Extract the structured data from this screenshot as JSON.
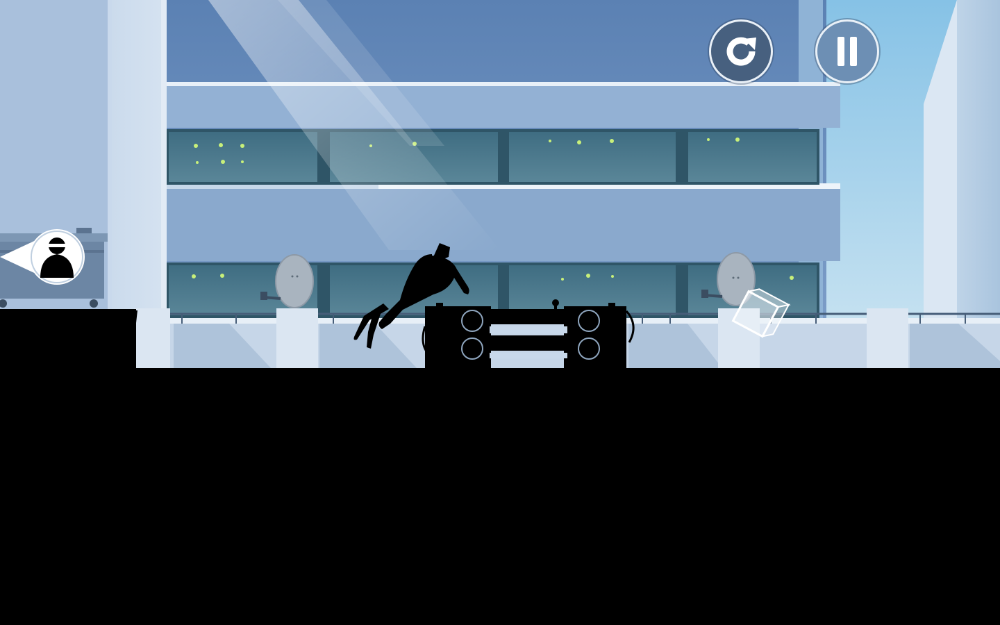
{
  "hud": {
    "restart_icon": "restart-icon",
    "pause_icon": "pause-icon",
    "restart_color": "#47607f",
    "pause_color": "#6d8fb4",
    "ring_color": "#e9f0f7"
  },
  "indicators": {
    "chaser_pointer_icon": "hunter-silhouette-icon",
    "direction": "left"
  },
  "palette": {
    "sky": "#9fd0ea",
    "building_face": "#5f84b3",
    "building_light": "#9db9d8",
    "window_glass": "#4c7a8e",
    "window_light": "#c8f07a",
    "ground": "#000000"
  }
}
